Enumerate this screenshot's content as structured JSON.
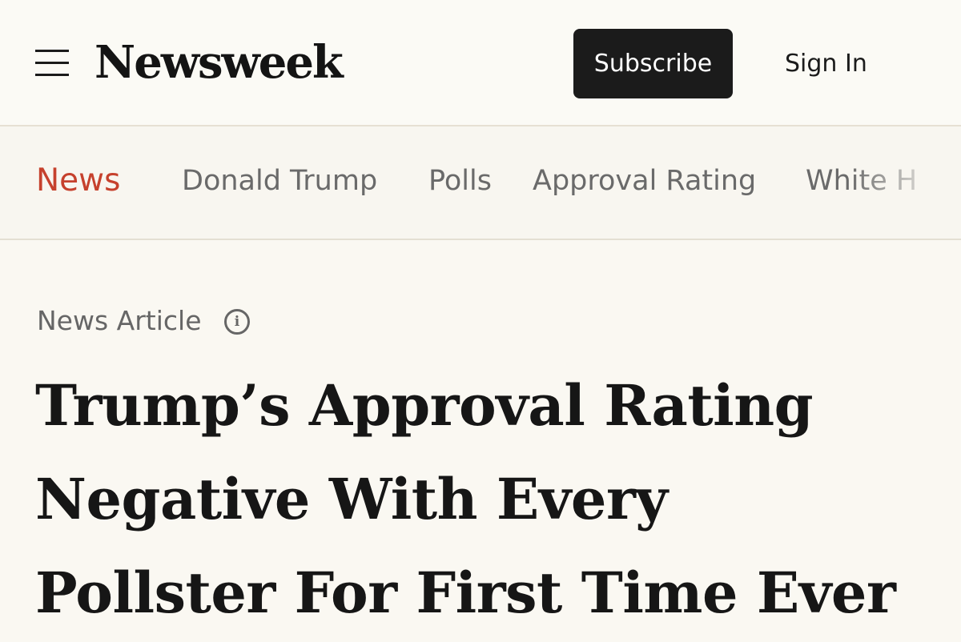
{
  "header": {
    "menu_icon": "hamburger-menu-icon",
    "logo": "Newsweek",
    "subscribe_label": "Subscribe",
    "signin_label": "Sign In"
  },
  "nav": {
    "items": [
      {
        "label": "News",
        "active": true
      },
      {
        "label": "Donald Trump",
        "active": false
      },
      {
        "label": "Polls",
        "active": false
      },
      {
        "label": "Approval Rating",
        "active": false
      },
      {
        "label": "White H",
        "active": false
      }
    ],
    "active_color": "#c6412d"
  },
  "article": {
    "type_label": "News Article",
    "info_icon": "info-icon",
    "headline_lines": [
      "Trump’s Approval Rating",
      "Negative With Every",
      "Pollster For First Time Ever"
    ]
  }
}
